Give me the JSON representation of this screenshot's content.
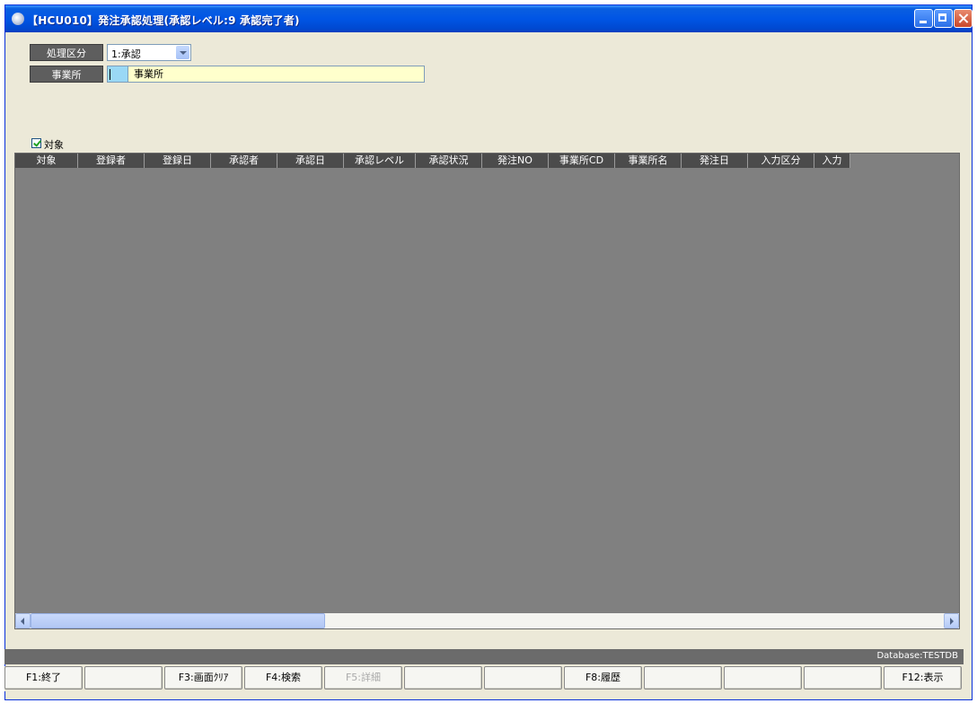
{
  "window": {
    "title": "【HCU010】発注承認処理(承認レベル:9 承認完了者)"
  },
  "criteria": {
    "process_label": "処理区分",
    "process_value": "1:承認",
    "office_label": "事業所",
    "office_name": "事業所"
  },
  "grid": {
    "checkbox_label": "対象",
    "columns": [
      "対象",
      "登録者",
      "登録日",
      "承認者",
      "承認日",
      "承認レベル",
      "承認状況",
      "発注NO",
      "事業所CD",
      "事業所名",
      "発注日",
      "入力区分",
      "入力"
    ]
  },
  "status": {
    "database": "Database:TESTDB"
  },
  "fkeys": [
    {
      "label": "F1:終了",
      "enabled": true
    },
    {
      "label": "",
      "enabled": true
    },
    {
      "label": "F3:画面ｸﾘｱ",
      "enabled": true
    },
    {
      "label": "F4:検索",
      "enabled": true
    },
    {
      "label": "F5:詳細",
      "enabled": false
    },
    {
      "label": "",
      "enabled": true
    },
    {
      "label": "",
      "enabled": true
    },
    {
      "label": "F8:履歴",
      "enabled": true
    },
    {
      "label": "",
      "enabled": true
    },
    {
      "label": "",
      "enabled": true
    },
    {
      "label": "",
      "enabled": true
    },
    {
      "label": "F12:表示",
      "enabled": true
    }
  ]
}
